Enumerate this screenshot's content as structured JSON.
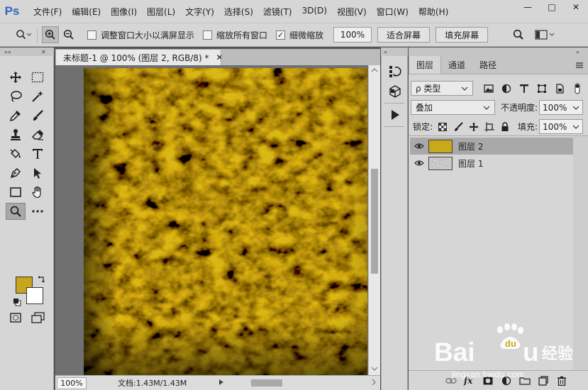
{
  "app": {
    "logo": "Ps"
  },
  "menu": [
    "文件(F)",
    "编辑(E)",
    "图像(I)",
    "图层(L)",
    "文字(Y)",
    "选择(S)",
    "滤镜(T)",
    "3D(D)",
    "视图(V)",
    "窗口(W)",
    "帮助(H)"
  ],
  "window_controls": {
    "minimize": "—",
    "restore": "□",
    "close": "✕"
  },
  "options": {
    "resize_windows": {
      "label": "调整窗口大小以满屏显示",
      "checked": false
    },
    "zoom_all": {
      "label": "缩放所有窗口",
      "checked": false
    },
    "scrubby_zoom": {
      "label": "细微缩放",
      "checked": true
    },
    "zoom_value": "100%",
    "fit_screen": "适合屏幕",
    "fill_screen": "填充屏幕"
  },
  "document": {
    "tab_title": "未标题-1 @ 100% (图层 2, RGB/8) *",
    "close": "✕",
    "status_zoom": "100%",
    "status_info": "文档:1.43M/1.43M"
  },
  "colors": {
    "foreground": "#c8a51a",
    "background": "#ffffff",
    "gold": "#c9a91c"
  },
  "layers_panel": {
    "tabs": [
      "图层",
      "通道",
      "路径"
    ],
    "filter_kind": "ρ 类型",
    "blend_mode": "叠加",
    "opacity_label": "不透明度:",
    "opacity_value": "100%",
    "lock_label": "锁定:",
    "fill_label": "填充:",
    "fill_value": "100%",
    "layers": [
      {
        "name": "图层 2",
        "selected": true,
        "visible": true,
        "thumb": "solid-gold"
      },
      {
        "name": "图层 1",
        "selected": false,
        "visible": true,
        "thumb": "noise-texture"
      }
    ]
  },
  "watermark": {
    "logo": "Bai du 经验",
    "url": "jingyan.baidu.com"
  }
}
